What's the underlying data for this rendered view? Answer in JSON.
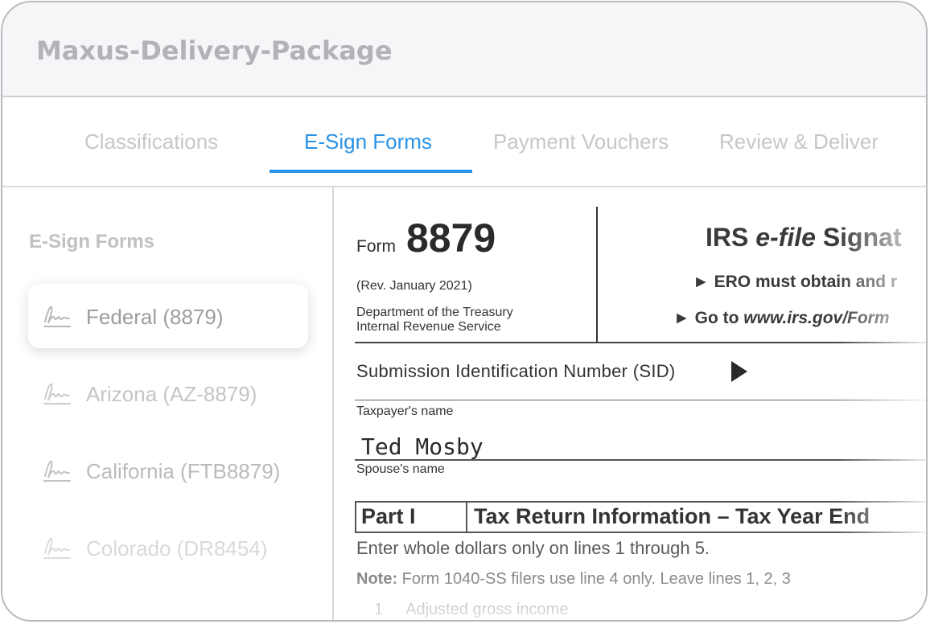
{
  "window": {
    "title": "Maxus-Delivery-Package"
  },
  "tabs": [
    {
      "label": "Classifications",
      "active": false
    },
    {
      "label": "E-Sign Forms",
      "active": true
    },
    {
      "label": "Payment Vouchers",
      "active": false
    },
    {
      "label": "Review & Deliver",
      "active": false
    }
  ],
  "sidebar": {
    "title": "E-Sign Forms",
    "items": [
      {
        "label": "Federal (8879)",
        "icon": "signature-icon",
        "active": true
      },
      {
        "label": "Arizona (AZ-8879)",
        "icon": "signature-icon",
        "active": false
      },
      {
        "label": "California (FTB8879)",
        "icon": "signature-icon",
        "active": false
      },
      {
        "label": "Colorado (DR8454)",
        "icon": "signature-icon",
        "active": false
      }
    ]
  },
  "document": {
    "form_word": "Form",
    "form_number": "8879",
    "revision": "(Rev. January 2021)",
    "department_line1": "Department of the Treasury",
    "department_line2": "Internal Revenue Service",
    "title_prefix": "IRS ",
    "title_italic": "e-file",
    "title_suffix": " Signat",
    "instruction1": "ERO must obtain and r",
    "instruction2_prefix": "Go to ",
    "instruction2_link": "www.irs.gov/Form",
    "sid_label": "Submission Identification Number (SID)",
    "taxpayer_label": "Taxpayer's name",
    "taxpayer_name": "Ted Mosby",
    "spouse_label": "Spouse's name",
    "part_label": "Part I",
    "part_title": "Tax Return Information – Tax Year End",
    "enter_text": "Enter whole dollars only on lines 1 through 5.",
    "note_label": "Note:",
    "note_text": " Form 1040-SS filers use line 4 only. Leave lines 1, 2, 3",
    "line1_number": "1",
    "line1_text": "Adjusted gross income"
  },
  "colors": {
    "accent": "#2a93e6",
    "muted_text": "#bbbabe",
    "title_text": "#b4b2b7"
  }
}
